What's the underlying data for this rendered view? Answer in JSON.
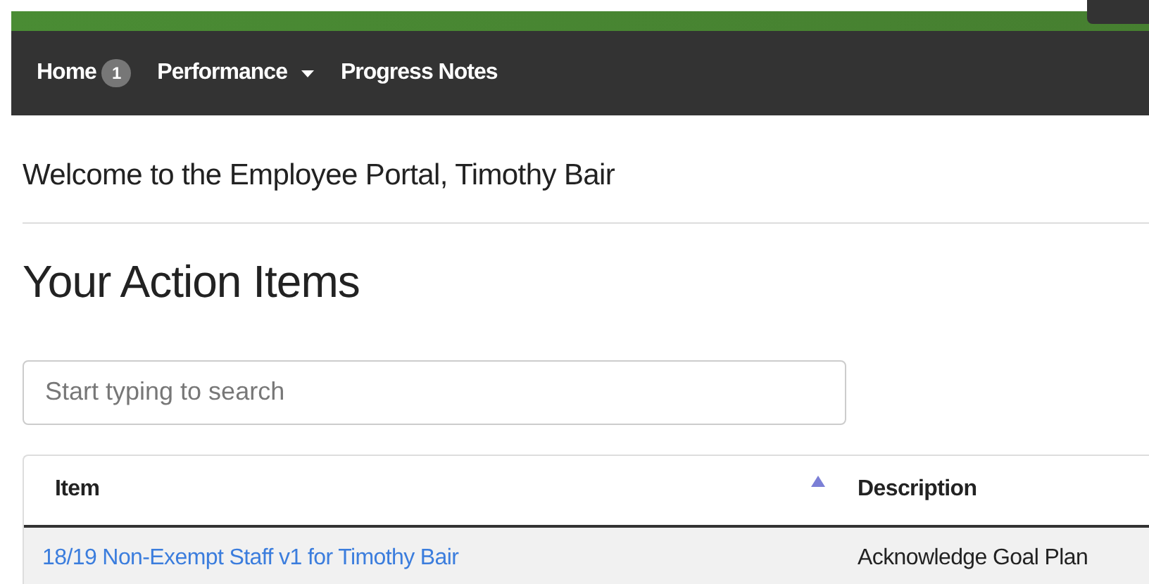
{
  "navbar": {
    "items": [
      {
        "label": "Home",
        "badge": "1",
        "dropdown": false
      },
      {
        "label": "Performance",
        "dropdown": true
      },
      {
        "label": "Progress Notes",
        "dropdown": false
      }
    ]
  },
  "welcome": "Welcome to the Employee Portal, Timothy Bair",
  "heading": "Your Action Items",
  "search": {
    "placeholder": "Start typing to search"
  },
  "table": {
    "columns": [
      {
        "label": "Item",
        "sorted": true
      },
      {
        "label": "Description",
        "sorted": false
      }
    ],
    "rows": [
      {
        "item": "18/19 Non-Exempt Staff v1 for Timothy Bair",
        "description": "Acknowledge Goal Plan"
      }
    ]
  }
}
